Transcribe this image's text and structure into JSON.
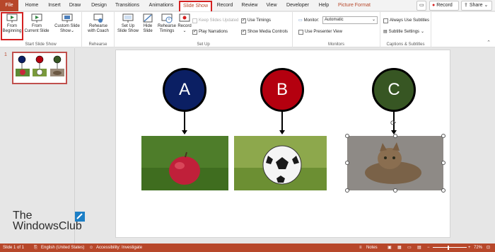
{
  "tabs": {
    "file": "File",
    "home": "Home",
    "insert": "Insert",
    "draw": "Draw",
    "design": "Design",
    "transitions": "Transitions",
    "animations": "Animations",
    "slide_show": "Slide Show",
    "record": "Record",
    "review": "Review",
    "view": "View",
    "developer": "Developer",
    "help": "Help",
    "picture_format": "Picture Format"
  },
  "top_actions": {
    "record": "Record",
    "share": "Share"
  },
  "ribbon": {
    "start": {
      "from_beginning_1": "From",
      "from_beginning_2": "Beginning",
      "from_current_1": "From",
      "from_current_2": "Current Slide",
      "custom_1": "Custom Slide",
      "custom_2": "Show",
      "label": "Start Slide Show"
    },
    "rehearse": {
      "rehearse_1": "Rehearse",
      "rehearse_2": "with Coach",
      "label": "Rehearse"
    },
    "setup": {
      "setup_1": "Set Up",
      "setup_2": "Slide Show",
      "hide_1": "Hide",
      "hide_2": "Slide",
      "timings_1": "Rehearse",
      "timings_2": "Timings",
      "record": "Record",
      "keep_updated": "Keep Slides Updated",
      "play_narrations": "Play Narrations",
      "use_timings": "Use Timings",
      "show_media": "Show Media Controls",
      "label": "Set Up"
    },
    "monitors": {
      "monitor_label": "Monitor:",
      "monitor_value": "Automatic",
      "presenter_view": "Use Presenter View",
      "label": "Monitors"
    },
    "captions": {
      "always_subtitles": "Always Use Subtitles",
      "subtitle_settings": "Subtitle Settings",
      "label": "Captions & Subtitles"
    }
  },
  "thumbnails": {
    "slide_number": "1"
  },
  "slide": {
    "circle_a": "A",
    "circle_b": "B",
    "circle_c": "C",
    "color_a": "#0b1f63",
    "color_b": "#b4000f",
    "color_c": "#375623"
  },
  "status": {
    "slide_of": "Slide 1 of 1",
    "language": "English (United States)",
    "accessibility": "Accessibility: Investigate",
    "notes": "Notes",
    "zoom": "72%"
  },
  "watermark": {
    "line1": "The",
    "line2": "WindowsClub"
  },
  "colors": {
    "accent": "#b7472a",
    "highlight": "#d42121"
  }
}
